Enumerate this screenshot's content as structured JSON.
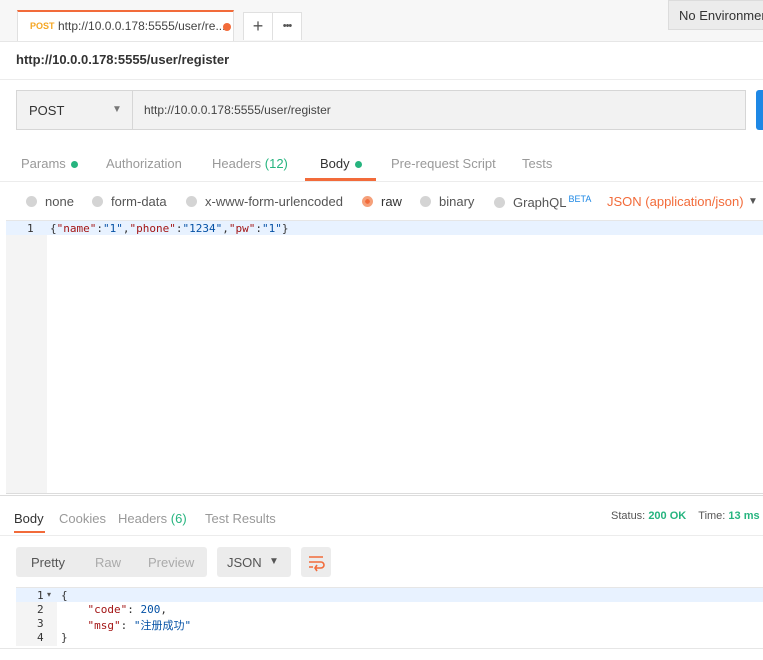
{
  "tab": {
    "method": "POST",
    "title": "http://10.0.0.178:5555/user/re..."
  },
  "toolbar": {
    "add_label": "+",
    "more_label": "•••"
  },
  "environment": {
    "label": "No Environment"
  },
  "request": {
    "url_title": "http://10.0.0.178:5555/user/register",
    "method": "POST",
    "url": "http://10.0.0.178:5555/user/register"
  },
  "request_tabs": {
    "params": "Params",
    "authorization": "Authorization",
    "headers": "Headers",
    "headers_count": "(12)",
    "body": "Body",
    "prerequest": "Pre-request Script",
    "tests": "Tests"
  },
  "body_types": {
    "none": "none",
    "form_data": "form-data",
    "urlencoded": "x-www-form-urlencoded",
    "raw": "raw",
    "binary": "binary",
    "graphql": "GraphQL",
    "beta": "BETA",
    "content_type": "JSON (application/json)",
    "selected": "raw"
  },
  "editor": {
    "line_numbers": [
      "1"
    ],
    "lines": [
      "{\"name\":\"1\",\"phone\":\"1234\",\"pw\":\"1\"}"
    ]
  },
  "response": {
    "tabs": {
      "body": "Body",
      "cookies": "Cookies",
      "headers": "Headers",
      "headers_count": "(6)",
      "test_results": "Test Results"
    },
    "status_label": "Status:",
    "status_value": "200 OK",
    "time_label": "Time:",
    "time_value": "13 ms",
    "view_modes": {
      "pretty": "Pretty",
      "raw": "Raw",
      "preview": "Preview"
    },
    "format": "JSON",
    "line_numbers": [
      "1",
      "2",
      "3",
      "4"
    ],
    "lines": [
      "{",
      "    \"code\": 200,",
      "    \"msg\": \"注册成功\"",
      "}"
    ]
  },
  "colors": {
    "accent": "#f26b3a",
    "success": "#26b47f",
    "link": "#1e88e5"
  }
}
